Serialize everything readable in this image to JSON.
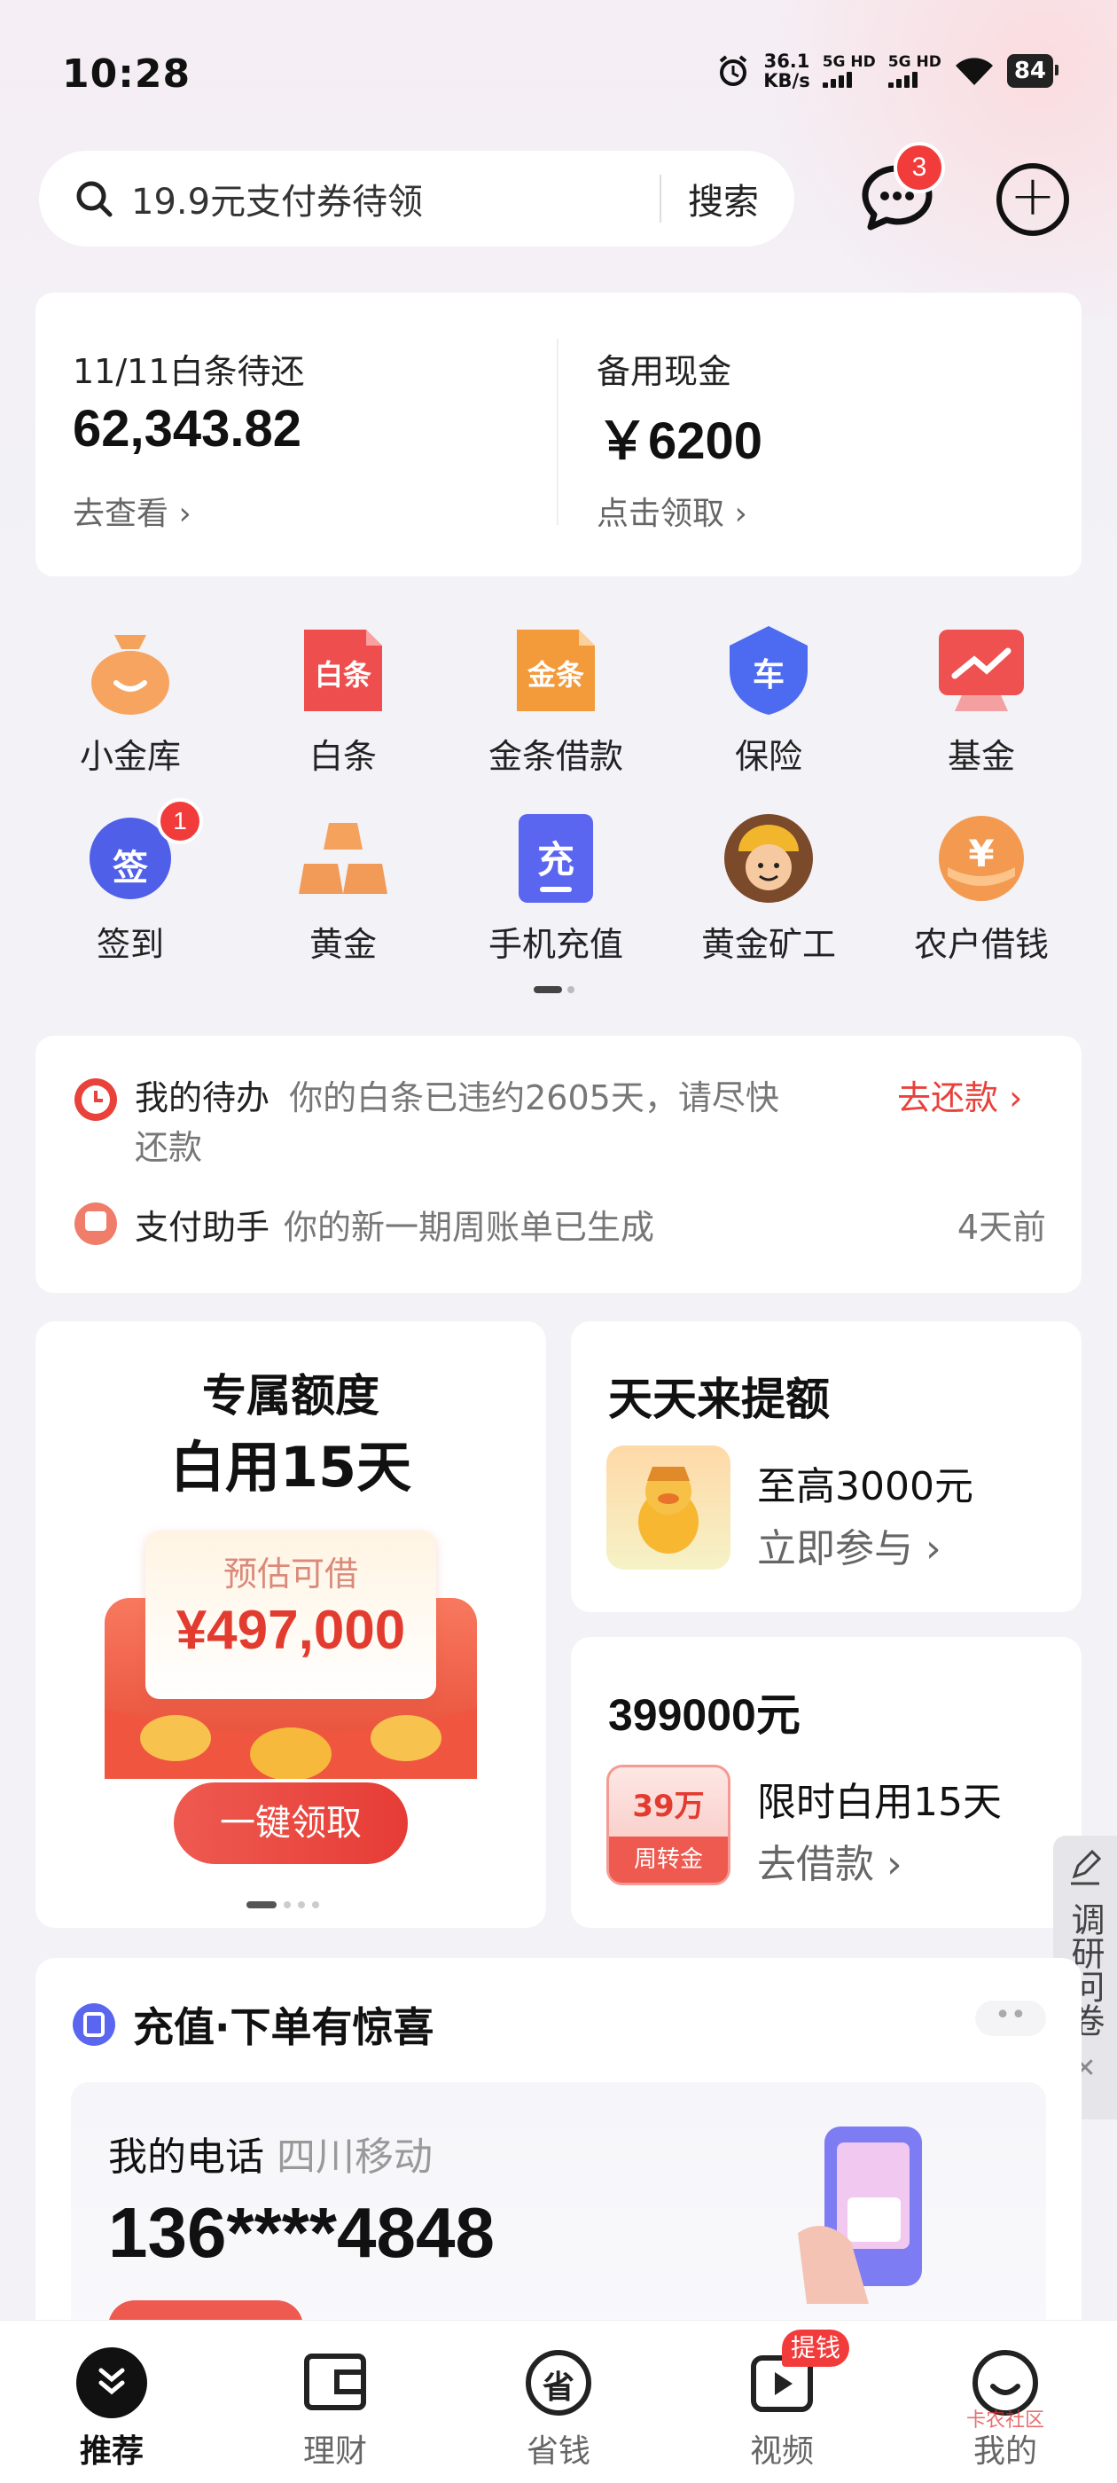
{
  "status_bar": {
    "time": "10:28",
    "speed_value": "36.1",
    "speed_unit": "KB/s",
    "sim1": "5G HD",
    "sim2": "5G HD",
    "battery": "84"
  },
  "header": {
    "search_placeholder": "19.9元支付券待领",
    "search_button": "搜索",
    "message_badge": "3"
  },
  "finance": {
    "left": {
      "label": "11/11白条待还",
      "value": "62,343.82",
      "link": "去查看"
    },
    "right": {
      "label": "备用现金",
      "value": "￥6200",
      "link": "点击领取"
    }
  },
  "grid": [
    {
      "label": "小金库",
      "icon": "wallet-bag-icon"
    },
    {
      "label": "白条",
      "icon": "baitiao-icon",
      "icon_text": "白条"
    },
    {
      "label": "金条借款",
      "icon": "jintiao-icon",
      "icon_text": "金条"
    },
    {
      "label": "保险",
      "icon": "insurance-shield-icon",
      "icon_text": "车"
    },
    {
      "label": "基金",
      "icon": "fund-chart-icon"
    },
    {
      "label": "签到",
      "icon": "checkin-icon",
      "icon_text": "签",
      "badge": "1"
    },
    {
      "label": "黄金",
      "icon": "gold-bars-icon"
    },
    {
      "label": "手机充值",
      "icon": "phone-recharge-icon",
      "icon_text": "充"
    },
    {
      "label": "黄金矿工",
      "icon": "gold-miner-avatar-icon"
    },
    {
      "label": "农户借钱",
      "icon": "farmer-loan-icon",
      "icon_text": "¥"
    }
  ],
  "todo": {
    "row1": {
      "title": "我的待办",
      "text": "你的白条已违约2605天，请尽快",
      "text2": "还款",
      "action": "去还款"
    },
    "row2": {
      "title": "支付助手",
      "text": "你的新一期周账单已生成",
      "time": "4天前"
    }
  },
  "promo_left": {
    "title1": "专属额度",
    "title2": "白用15天",
    "est_label": "预估可借",
    "amount": "¥497,000",
    "button": "一键领取"
  },
  "promo_right_top": {
    "title": "天天来提额",
    "line1": "至高3000元",
    "line2": "立即参与"
  },
  "promo_right_bottom": {
    "title": "399000元",
    "tag_top": "39万",
    "tag_bottom": "周转金",
    "line1": "限时白用15天",
    "line2": "去借款"
  },
  "recharge": {
    "title": "充值·下单有惊喜",
    "phone_label": "我的电话",
    "carrier": "四川移动",
    "phone": "136****4848"
  },
  "survey": {
    "label": "调研问卷"
  },
  "tabs": [
    {
      "label": "推荐",
      "icon": "home-chevron-icon"
    },
    {
      "label": "理财",
      "icon": "wallet-icon"
    },
    {
      "label": "省钱",
      "icon": "save-money-icon"
    },
    {
      "label": "视频",
      "icon": "video-play-icon",
      "badge": "提钱"
    },
    {
      "label": "我的",
      "icon": "profile-smile-icon"
    }
  ],
  "watermark": "卡农社区"
}
